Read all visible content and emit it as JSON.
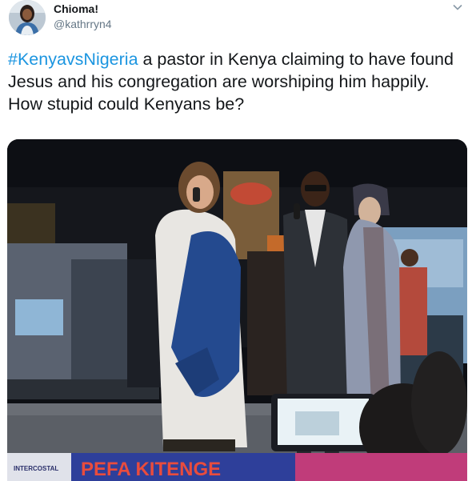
{
  "tweet": {
    "display_name": "Chioma!",
    "handle": "@kathrryn4",
    "hashtag": "#KenyavsNigeria",
    "body": " a pastor in Kenya claiming to have found Jesus and his congregation are worshiping him happily. How stupid could Kenyans be?",
    "caret_icon": "chevron-down-icon",
    "accent_color": "#1b95e0"
  },
  "media": {
    "banner_main": "PEFA KITENGE",
    "banner_small": "INTERCOSTAL"
  }
}
